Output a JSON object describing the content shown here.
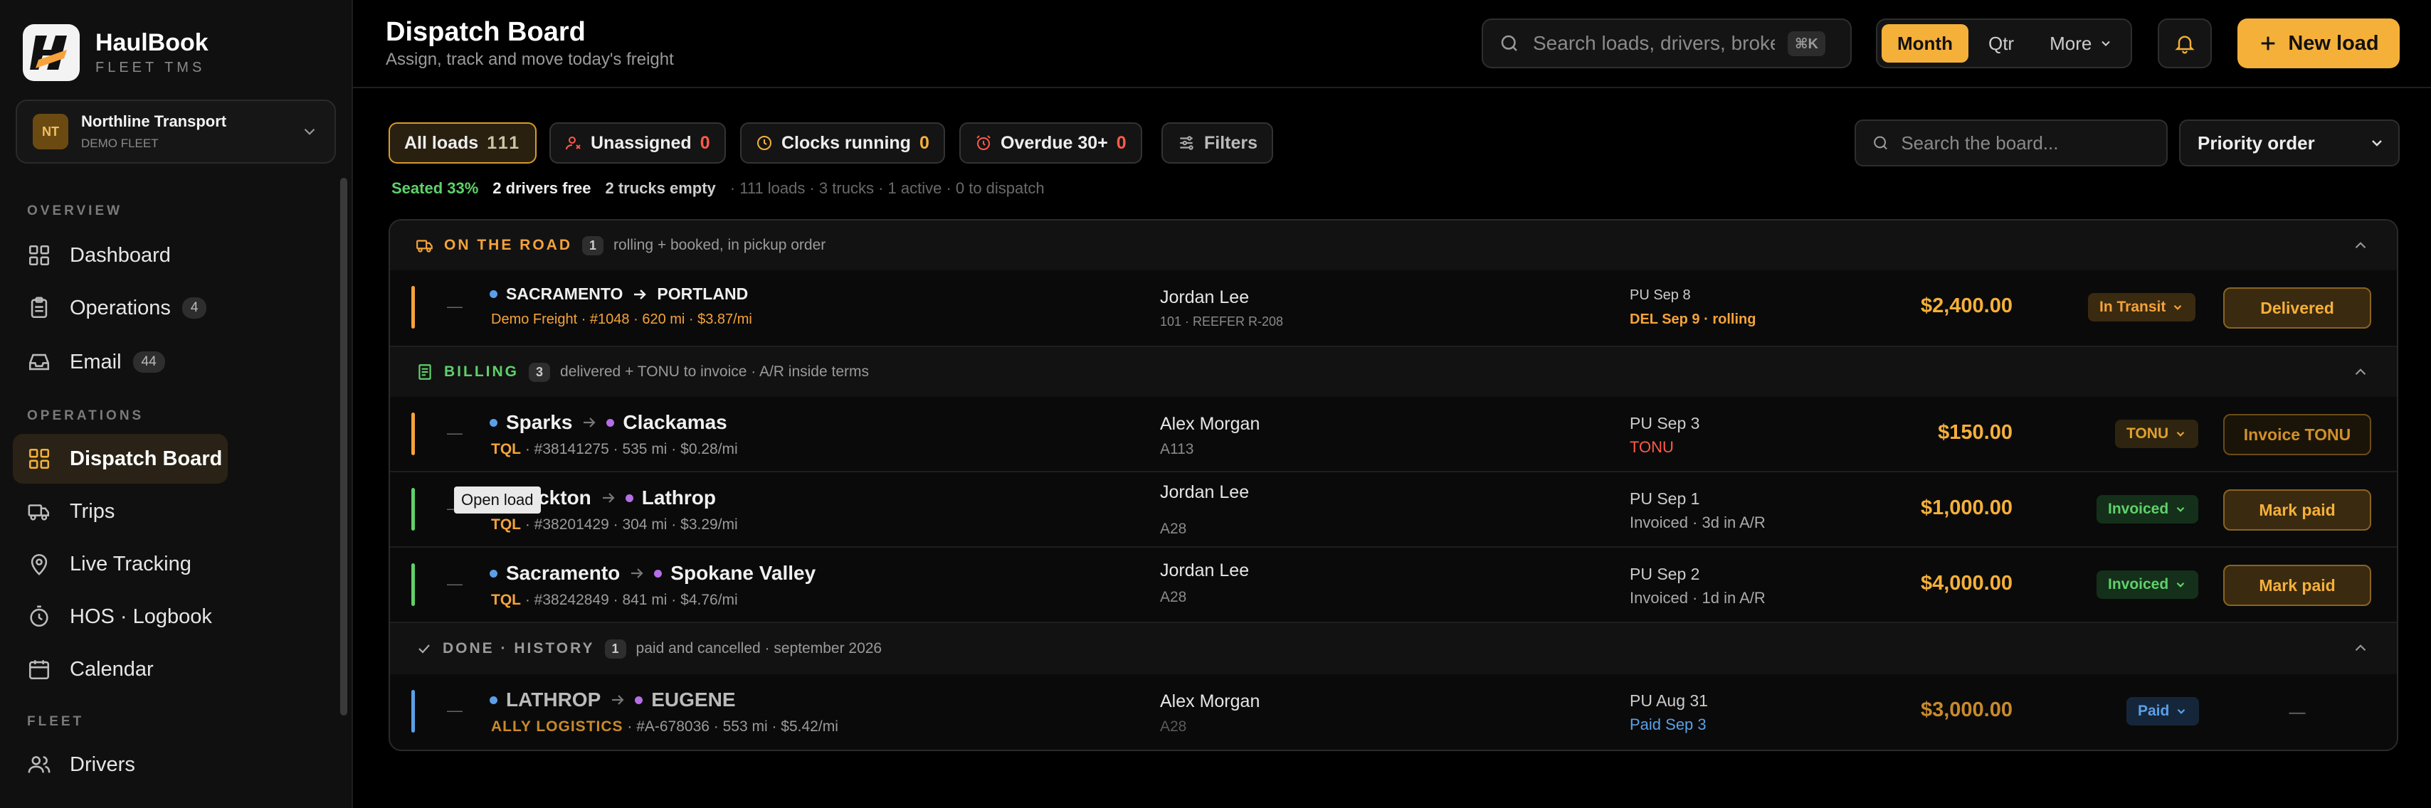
{
  "brand": {
    "name": "HaulBook",
    "sub": "FLEET TMS"
  },
  "org": {
    "initials": "NT",
    "name": "Northline Transport",
    "sub": "DEMO FLEET"
  },
  "nav": {
    "overview_label": "OVERVIEW",
    "operations_label": "OPERATIONS",
    "fleet_label": "FLEET",
    "items": [
      {
        "label": "Dashboard"
      },
      {
        "label": "Operations",
        "count": "4"
      },
      {
        "label": "Email",
        "count": "44"
      },
      {
        "label": "Dispatch Board"
      },
      {
        "label": "Trips"
      },
      {
        "label": "Live Tracking"
      },
      {
        "label": "HOS · Logbook"
      },
      {
        "label": "Calendar"
      },
      {
        "label": "Drivers"
      }
    ]
  },
  "header": {
    "title": "Dispatch Board",
    "subtitle": "Assign, track and move today's freight",
    "search_placeholder": "Search loads, drivers, brokers",
    "search_kbd": "⌘K",
    "periods": [
      "Month",
      "Qtr",
      "More"
    ],
    "new_load": "New load"
  },
  "filters": {
    "chips": [
      {
        "label": "All loads",
        "count": "111"
      },
      {
        "label": "Unassigned",
        "count": "0"
      },
      {
        "label": "Clocks running",
        "count": "0"
      },
      {
        "label": "Overdue 30+",
        "count": "0"
      },
      {
        "label": "Filters"
      }
    ],
    "board_search_placeholder": "Search the board...",
    "sort": "Priority order"
  },
  "stats": {
    "seated": "Seated 33%",
    "drivers_free": "2 drivers free",
    "trucks_empty": "2 trucks empty",
    "summary": "· 111 loads · 3 trucks · 1 active · 0 to dispatch"
  },
  "groups": [
    {
      "label": "ON THE ROAD",
      "count": "1",
      "desc": "rolling + booked, in pickup order",
      "color": "#f5a33a"
    },
    {
      "label": "BILLING",
      "count": "3",
      "desc": "delivered + TONU to invoice · A/R inside terms",
      "color": "#5fd16a"
    },
    {
      "label": "DONE · HISTORY",
      "count": "1",
      "desc": "paid and cancelled · september 2026",
      "color": "#9a9a9a"
    }
  ],
  "rows": [
    {
      "origin": "SACRAMENTO",
      "dest": "PORTLAND",
      "broker": "Demo Freight",
      "meta": "· #1048 · 620 mi · $3.87/mi",
      "driver": "Jordan Lee",
      "truck": "101 · REEFER R-208",
      "pu": "PU Sep 8",
      "pu2": "DEL Sep 9 · rolling",
      "amount": "$2,400.00",
      "status": "In Transit",
      "action": "Delivered",
      "dash": "—"
    },
    {
      "origin": "Sparks",
      "dest": "Clackamas",
      "broker": "TQL",
      "meta": "· #38141275 · 535 mi · $0.28/mi",
      "driver": "Alex Morgan",
      "truck": "A113",
      "pu": "PU Sep 3",
      "pu2": "TONU",
      "amount": "$150.00",
      "status": "TONU",
      "action": "Invoice TONU",
      "dash": "—"
    },
    {
      "origin": "Stockton",
      "dest": "Lathrop",
      "broker": "TQL",
      "meta": "· #38201429 · 304 mi · $3.29/mi",
      "driver": "Jordan Lee",
      "truck": "A28",
      "pu": "PU Sep 1",
      "pu2": "Invoiced · 3d in A/R",
      "amount": "$1,000.00",
      "status": "Invoiced",
      "action": "Mark paid",
      "dash": "—"
    },
    {
      "origin": "Sacramento",
      "dest": "Spokane Valley",
      "broker": "TQL",
      "meta": "· #38242849 · 841 mi · $4.76/mi",
      "driver": "Jordan Lee",
      "truck": "A28",
      "pu": "PU Sep 2",
      "pu2": "Invoiced · 1d in A/R",
      "amount": "$4,000.00",
      "status": "Invoiced",
      "action": "Mark paid",
      "dash": "—"
    },
    {
      "origin": "LATHROP",
      "dest": "EUGENE",
      "broker": "ALLY LOGISTICS",
      "meta": "· #A-678036 · 553 mi · $5.42/mi",
      "driver": "Alex Morgan",
      "truck": "A28",
      "pu": "PU Aug 31",
      "pu2": "Paid Sep 3",
      "amount": "$3,000.00",
      "status": "Paid",
      "action": "—",
      "dash": "—"
    }
  ],
  "tooltip": "Open load",
  "colors": {
    "accent": "#f5b03a",
    "green": "#5fd16a",
    "red": "#ff5a4a",
    "blue": "#5aa0e8",
    "purple": "#b56ee6"
  }
}
